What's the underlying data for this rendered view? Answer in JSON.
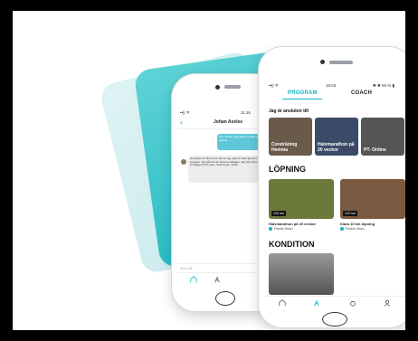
{
  "back_phone": {
    "status": {
      "signal": "••|| ᯤ",
      "time": "11:16"
    },
    "header": {
      "back_icon": "chevron-left-icon",
      "contact_name": "Johan Axelss"
    },
    "messages": [
      {
        "side": "right",
        "text": "Hej, Johan! Jag hade en fråga om träning..."
      },
      {
        "side": "left",
        "text": "Hej Rasmus! Bra att du hör av dig, jag har kikat igenom ditt program. Det går bra att ändra upplägget, säg bara till om du vill lägga till fler pass. Hälsningar, Johan"
      }
    ],
    "input_placeholder": "Skriv här",
    "tabbar": [
      "home-icon",
      "run-icon"
    ]
  },
  "front_phone": {
    "status": {
      "signal": "••|| ᯤ",
      "time": "16:53",
      "battery": "✱ ✱ 59 % ▮"
    },
    "tabs": {
      "program": "PROGRAM",
      "coach": "COACH"
    },
    "sections": [
      {
        "title": "Jag är ansluten till",
        "cards": [
          {
            "label": "Coreträning Hemma",
            "color": "#6a5a4a"
          },
          {
            "label": "Halvmarathon på 20 veckor",
            "color": "#3b4a66"
          },
          {
            "label": "PT- Online",
            "color": "#555555"
          }
        ]
      },
      {
        "title": "LÖPNING",
        "cards": [
          {
            "badge": "12V km",
            "caption": "Halvmarathon på 20 veckor",
            "author": "Fredrik Sewn",
            "color": "#6b7a3a"
          },
          {
            "badge": "12V km",
            "caption": "Klara 10 km löpning",
            "author": "Fredrik Sewn",
            "color": "#7a5a40"
          }
        ]
      },
      {
        "title": "KONDITION",
        "cards": [
          {
            "color": "#777777"
          }
        ]
      }
    ],
    "tabbar": [
      "home-icon",
      "run-icon",
      "kettlebell-icon",
      "profile-icon"
    ],
    "accent": "#12b3c2"
  },
  "background_cards": {
    "light": "#c4e8ea",
    "teal": "#1fb6c2"
  }
}
